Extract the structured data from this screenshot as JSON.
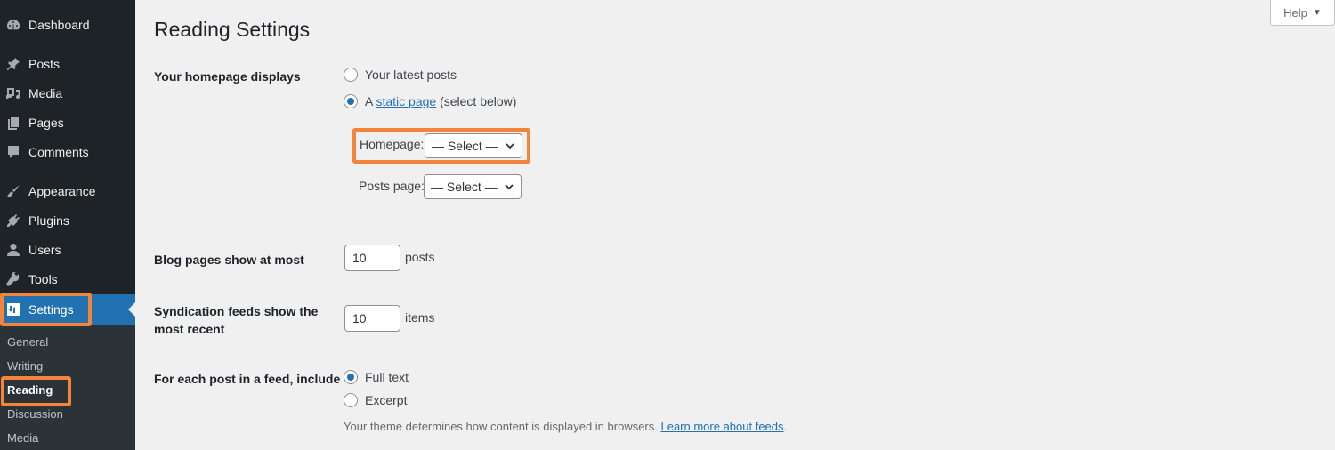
{
  "sidebar": {
    "items": [
      {
        "label": "Dashboard",
        "icon": "dashboard-icon"
      },
      {
        "label": "Posts",
        "icon": "pin-icon"
      },
      {
        "label": "Media",
        "icon": "media-icon"
      },
      {
        "label": "Pages",
        "icon": "pages-icon"
      },
      {
        "label": "Comments",
        "icon": "comment-icon"
      },
      {
        "label": "Appearance",
        "icon": "brush-icon"
      },
      {
        "label": "Plugins",
        "icon": "plug-icon"
      },
      {
        "label": "Users",
        "icon": "user-icon"
      },
      {
        "label": "Tools",
        "icon": "wrench-icon"
      },
      {
        "label": "Settings",
        "icon": "settings-icon",
        "active": true
      }
    ],
    "submenu": [
      {
        "label": "General"
      },
      {
        "label": "Writing"
      },
      {
        "label": "Reading",
        "current": true
      },
      {
        "label": "Discussion"
      },
      {
        "label": "Media"
      }
    ]
  },
  "header": {
    "title": "Reading Settings",
    "help_label": "Help",
    "help_caret": "▼"
  },
  "homepage_displays": {
    "label": "Your homepage displays",
    "options": [
      {
        "label": "Your latest posts",
        "checked": false
      },
      {
        "prefix": "A ",
        "link": "static page",
        "suffix": " (select below)",
        "checked": true
      }
    ],
    "homepage_select": {
      "label": "Homepage:",
      "value": "— Select —"
    },
    "posts_page_select": {
      "label": "Posts page:",
      "value": "— Select —"
    }
  },
  "blog_pages": {
    "label": "Blog pages show at most",
    "value": "10",
    "unit": "posts"
  },
  "syndication": {
    "label_line1": "Syndication feeds show the",
    "label_line2": "most recent",
    "value": "10",
    "unit": "items"
  },
  "feed_content": {
    "label": "For each post in a feed, include",
    "options": [
      {
        "label": "Full text",
        "checked": true
      },
      {
        "label": "Excerpt",
        "checked": false
      }
    ],
    "description": "Your theme determines how content is displayed in browsers. ",
    "learn_more": "Learn more about feeds",
    "period": "."
  },
  "colors": {
    "accent": "#2271b1",
    "sidebar_bg": "#1d2327",
    "submenu_bg": "#2c3338",
    "highlight": "#f4843a"
  }
}
